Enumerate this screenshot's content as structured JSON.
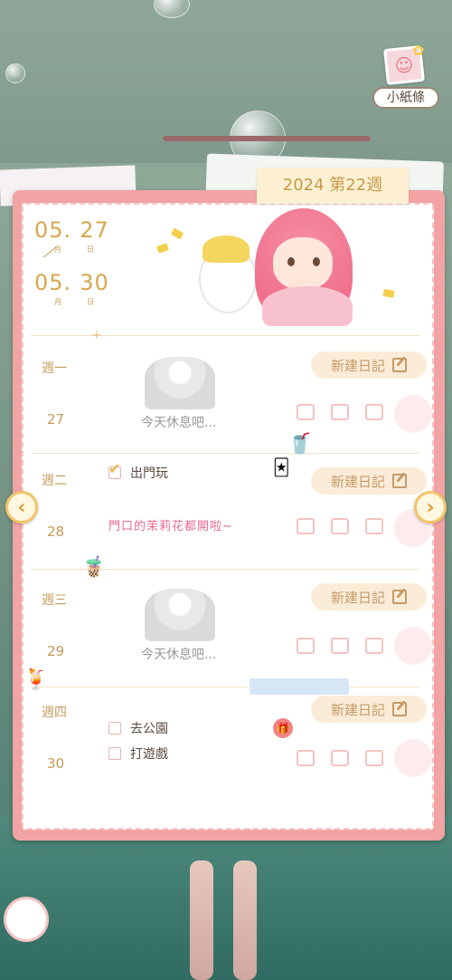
{
  "note_button": {
    "label": "小紙條"
  },
  "header": {
    "week_label": "2024 第22週"
  },
  "date_range": {
    "start_month": "05.",
    "start_day": "27",
    "end_month": "05.",
    "end_day": "30",
    "month_unit": "月",
    "day_unit": "日"
  },
  "new_diary_label": "新建日記",
  "days": [
    {
      "weekday": "週一",
      "date": "27",
      "rest_text": "今天休息吧..."
    },
    {
      "weekday": "週二",
      "date": "28",
      "todo_done": "出門玩",
      "memo": "門口的茉莉花都開啦~"
    },
    {
      "weekday": "週三",
      "date": "29",
      "rest_text": "今天休息吧..."
    },
    {
      "weekday": "週四",
      "date": "30",
      "todo_1": "去公園",
      "todo_2": "打遊戲"
    }
  ],
  "nav": {
    "prev_icon": "chevron-left-icon",
    "next_icon": "chevron-right-icon",
    "prev_glyph": "‹",
    "next_glyph": "›"
  },
  "colors": {
    "accent": "#f2c56a",
    "pink": "#f2a3a3",
    "memo": "#e86b8e"
  }
}
